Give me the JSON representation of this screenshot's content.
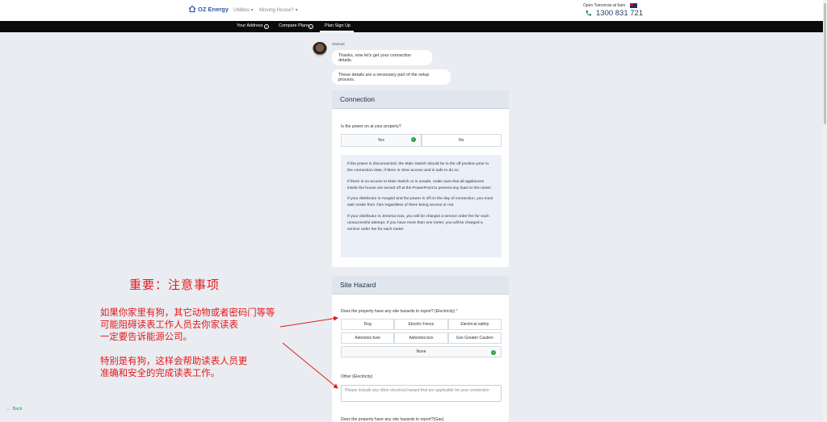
{
  "header": {
    "logo_text": "OZ Energy",
    "menu": [
      "Utilities ▾",
      "Moving House? ▾"
    ],
    "open_text": "Open Tomorrow at 9am",
    "phone": "1300 831 721",
    "icons": [
      "house-icon",
      "flag-icon",
      "phone-icon"
    ]
  },
  "nav": {
    "items": [
      "Your Address",
      "Compare Plans",
      "Plan Sign Up"
    ],
    "active": "Plan Sign Up"
  },
  "chat": {
    "agent_name": "Samuel",
    "messages": [
      "Thanks, now let's get your connection details.",
      "These details are a necessary part of the setup process."
    ]
  },
  "connection": {
    "title": "Connection",
    "question": "Is the power on at your property?",
    "options": [
      "Yes",
      "No"
    ],
    "selected": "Yes",
    "info": [
      "If the power is disconnected, the Main Switch should be in the off position prior to the connection date, if there is clear access and is safe to do so.",
      "If there is no access to Main Switch or is unsafe, make sure that all appliances inside the house are turned off at the PowerPoint to prevent any load on the meter.",
      "If your distributor is Ausgrid and the power is off on the day of connection, you must wait onsite from 7am regardless of there being access or not.",
      "If your distributor is Jemena Gas, you will be charged a service order fee for each unsuccessful attempt. If you have more than one meter, you will be charged a service order fee for each meter."
    ]
  },
  "site_hazard": {
    "title": "Site Hazard",
    "question_electricity": "Does the property have any site hazards to report? (Electricity)",
    "required_mark": "*",
    "options_row1": [
      "Dog",
      "Electric Fence",
      "Electrical safety"
    ],
    "options_row2": [
      "Asbestos fuse",
      "Asbestos box",
      "Use Greater Caution"
    ],
    "option_none": "None",
    "selected": "None",
    "other_label": "Other (Electricity)",
    "other_placeholder": "Please include any other electrical hazard that are applicable for your connection",
    "question_gas": "Does the property have any site hazards to report?(Gas)"
  },
  "annotation": {
    "title": "重要：注意事项",
    "text_1": "如果你家里有狗，其它动物或者密码门等等\n可能阻碍读表工作人员去你家读表\n一定要告诉能源公司。",
    "text_2": "特别是有狗，这样会帮助读表人员更\n准确和安全的完成读表工作。",
    "color": "#e4181a"
  },
  "back": {
    "label": "Back"
  },
  "colors": {
    "nav_bg": "#0b0b0b",
    "accent_green": "#25a244",
    "card_head": "#dfe6ee",
    "info_bg": "#ebf0f8"
  }
}
